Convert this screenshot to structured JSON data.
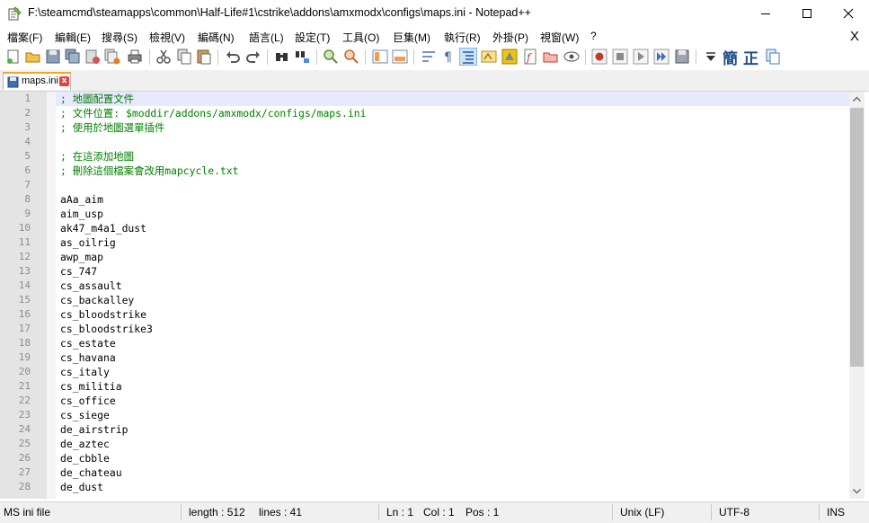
{
  "window": {
    "title": "F:\\steamcmd\\steamapps\\common\\Half-Life#1\\cstrike\\addons\\amxmodx\\configs\\maps.ini - Notepad++"
  },
  "menu": {
    "items": [
      "檔案(F)",
      "編輯(E)",
      "搜尋(S)",
      "檢視(V)",
      "編碼(N)",
      "語言(L)",
      "設定(T)",
      "工具(O)",
      "巨集(M)",
      "執行(R)",
      "外掛(P)",
      "視窗(W)",
      "?"
    ],
    "close_label": "X"
  },
  "toolbar": {
    "glyph_traditional": "簡",
    "glyph_correct": "正"
  },
  "tab": {
    "label": "maps.ini",
    "close_label": "x"
  },
  "editor": {
    "lines": [
      {
        "n": "1",
        "text": "; 地圖配置文件",
        "comment": true,
        "current": true
      },
      {
        "n": "2",
        "text": "; 文件位置: $moddir/addons/amxmodx/configs/maps.ini",
        "comment": true
      },
      {
        "n": "3",
        "text": "; 使用於地圖選單插件",
        "comment": true
      },
      {
        "n": "4",
        "text": "",
        "comment": false
      },
      {
        "n": "5",
        "text": "; 在這添加地圖",
        "comment": true
      },
      {
        "n": "6",
        "text": "; 刪除這個檔案會改用mapcycle.txt",
        "comment": true
      },
      {
        "n": "7",
        "text": "",
        "comment": false
      },
      {
        "n": "8",
        "text": "aAa_aim",
        "comment": false
      },
      {
        "n": "9",
        "text": "aim_usp",
        "comment": false
      },
      {
        "n": "10",
        "text": "ak47_m4a1_dust",
        "comment": false
      },
      {
        "n": "11",
        "text": "as_oilrig",
        "comment": false
      },
      {
        "n": "12",
        "text": "awp_map",
        "comment": false
      },
      {
        "n": "13",
        "text": "cs_747",
        "comment": false
      },
      {
        "n": "14",
        "text": "cs_assault",
        "comment": false
      },
      {
        "n": "15",
        "text": "cs_backalley",
        "comment": false
      },
      {
        "n": "16",
        "text": "cs_bloodstrike",
        "comment": false
      },
      {
        "n": "17",
        "text": "cs_bloodstrike3",
        "comment": false
      },
      {
        "n": "18",
        "text": "cs_estate",
        "comment": false
      },
      {
        "n": "19",
        "text": "cs_havana",
        "comment": false
      },
      {
        "n": "20",
        "text": "cs_italy",
        "comment": false
      },
      {
        "n": "21",
        "text": "cs_militia",
        "comment": false
      },
      {
        "n": "22",
        "text": "cs_office",
        "comment": false
      },
      {
        "n": "23",
        "text": "cs_siege",
        "comment": false
      },
      {
        "n": "24",
        "text": "de_airstrip",
        "comment": false
      },
      {
        "n": "25",
        "text": "de_aztec",
        "comment": false
      },
      {
        "n": "26",
        "text": "de_cbble",
        "comment": false
      },
      {
        "n": "27",
        "text": "de_chateau",
        "comment": false
      },
      {
        "n": "28",
        "text": "de_dust",
        "comment": false
      }
    ]
  },
  "status": {
    "file_type": "MS ini file",
    "length": "length : 512",
    "lines": "lines : 41",
    "ln": "Ln : 1",
    "col": "Col : 1",
    "pos": "Pos : 1",
    "eol": "Unix (LF)",
    "encoding": "UTF-8",
    "mode": "INS"
  },
  "colors": {
    "comment": "#008000",
    "current_line": "#e8e8ff",
    "gutter": "#e4e4e4"
  }
}
